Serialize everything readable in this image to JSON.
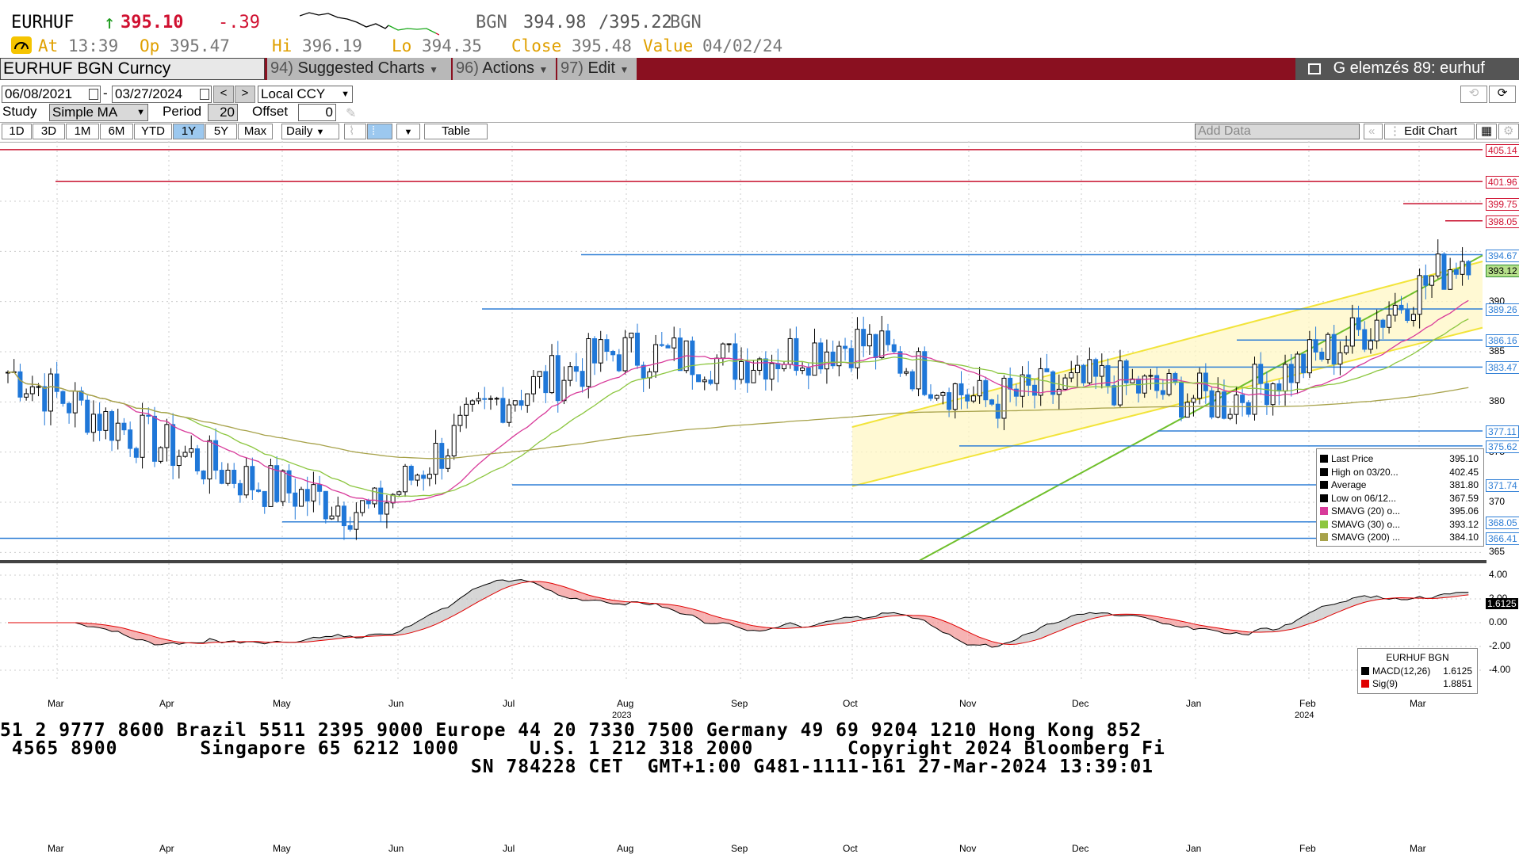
{
  "header": {
    "ticker": "EURHUF",
    "last": "395.10",
    "change": "-.39",
    "bid_src": "BGN",
    "bid": "394.98",
    "ask": "/395.22",
    "ask_src": "BGN",
    "at_label": "At",
    "at_time": "13:39",
    "op_label": "Op",
    "op": "395.47",
    "hi_label": "Hi",
    "hi": "396.19",
    "lo_label": "Lo",
    "lo": "394.35",
    "close_label": "Close",
    "close": "395.48",
    "value_label": "Value",
    "value_date": "04/02/24"
  },
  "toolbar": {
    "security": "EURHUF BGN Curncy",
    "suggested_num": "94)",
    "suggested": "Suggested Charts",
    "actions_num": "96)",
    "actions": "Actions",
    "edit_num": "97)",
    "edit": "Edit",
    "title": "G elemzés 89: eurhuf"
  },
  "controls": {
    "start_date": "06/08/2021",
    "end_date": "03/27/2024",
    "currency": "Local CCY",
    "study_label": "Study",
    "study": "Simple MA",
    "period_label": "Period",
    "period": "20",
    "offset_label": "Offset",
    "offset": "0",
    "ranges": [
      "1D",
      "3D",
      "1M",
      "6M",
      "YTD",
      "1Y",
      "5Y",
      "Max"
    ],
    "selected_range": "1Y",
    "frequency": "Daily",
    "table": "Table",
    "add_data": "Add Data",
    "edit_chart": "Edit Chart"
  },
  "colors": {
    "accent_bar": "#8a1020",
    "up": "#000000",
    "down": "#1f77d8",
    "sma20": "#d83a9a",
    "sma30": "#8cc63f",
    "sma200": "#a7a24a",
    "level_line": "#2f7fd6",
    "red_line": "#c8102e"
  },
  "chart_data": [
    {
      "type": "candlestick",
      "ylim": [
        364,
        406
      ],
      "yticks": [
        365,
        370,
        375,
        380,
        385,
        390
      ],
      "xticks": [
        "Mar",
        "Apr",
        "May",
        "Jun",
        "Jul",
        "Aug",
        "Sep",
        "Oct",
        "Nov",
        "Dec",
        "Jan",
        "Feb",
        "Mar"
      ],
      "year_labels": [
        "2023",
        "2024"
      ],
      "price_labels": [
        {
          "value": 405.14,
          "kind": "red"
        },
        {
          "value": 401.96,
          "kind": "red"
        },
        {
          "value": 399.75,
          "kind": "red"
        },
        {
          "value": 398.05,
          "kind": "red"
        },
        {
          "value": 394.67,
          "kind": "blue"
        },
        {
          "value": 393.12,
          "kind": "green"
        },
        {
          "value": 389.26,
          "kind": "blue"
        },
        {
          "value": 386.16,
          "kind": "blue"
        },
        {
          "value": 383.47,
          "kind": "blue"
        },
        {
          "value": 377.11,
          "kind": "blue"
        },
        {
          "value": 375.62,
          "kind": "blue"
        },
        {
          "value": 371.74,
          "kind": "blue"
        },
        {
          "value": 368.05,
          "kind": "blue"
        },
        {
          "value": 366.41,
          "kind": "blue"
        }
      ],
      "series": [
        {
          "name": "Last Price",
          "monthly_close": [
            383,
            377,
            372,
            369,
            380,
            385,
            384,
            386,
            380,
            382,
            380,
            386,
            395
          ]
        },
        {
          "name": "SMAVG (20)",
          "last": 395.06
        },
        {
          "name": "SMAVG (30)",
          "last": 393.12
        },
        {
          "name": "SMAVG (200)",
          "last": 384.1
        }
      ],
      "legend": [
        {
          "label": "Last Price",
          "value": "395.10",
          "color": "#000000"
        },
        {
          "label": "High on 03/20...",
          "value": "402.45",
          "color": "#000000"
        },
        {
          "label": "Average",
          "value": "381.80",
          "color": "#000000"
        },
        {
          "label": "Low on 06/12...",
          "value": "367.59",
          "color": "#000000"
        },
        {
          "label": "SMAVG (20)   o...",
          "value": "395.06",
          "color": "#d83a9a"
        },
        {
          "label": "SMAVG (30)   o...",
          "value": "393.12",
          "color": "#8cc63f"
        },
        {
          "label": "SMAVG (200) ...",
          "value": "384.10",
          "color": "#a7a24a"
        }
      ],
      "legend_placement": "bottom-right"
    },
    {
      "type": "line",
      "name": "EURHUF BGN",
      "ylim": [
        -5,
        5
      ],
      "yticks": [
        "4.00",
        "2.00",
        "0.00",
        "-2.00",
        "-4.00"
      ],
      "current_value_label": "1.6125",
      "legend": [
        {
          "label": "MACD(12,26)",
          "value": "1.6125",
          "color": "#000000"
        },
        {
          "label": "Sig(9)",
          "value": "1.8851",
          "color": "#e00000"
        }
      ],
      "legend_placement": "bottom-right"
    }
  ],
  "footer": {
    "line1": "51 2 9777 8600 Brazil 5511 2395 9000 Europe 44 20 7330 7500 Germany 49 69 9204 1210 Hong Kong 852",
    "line2": " 4565 8900       Singapore 65 6212 1000      U.S. 1 212 318 2000        Copyright 2024 Bloomberg Fi",
    "line3": "                                        SN 784228 CET  GMT+1:00 G481-1111-161 27-Mar-2024 13:39:01"
  }
}
